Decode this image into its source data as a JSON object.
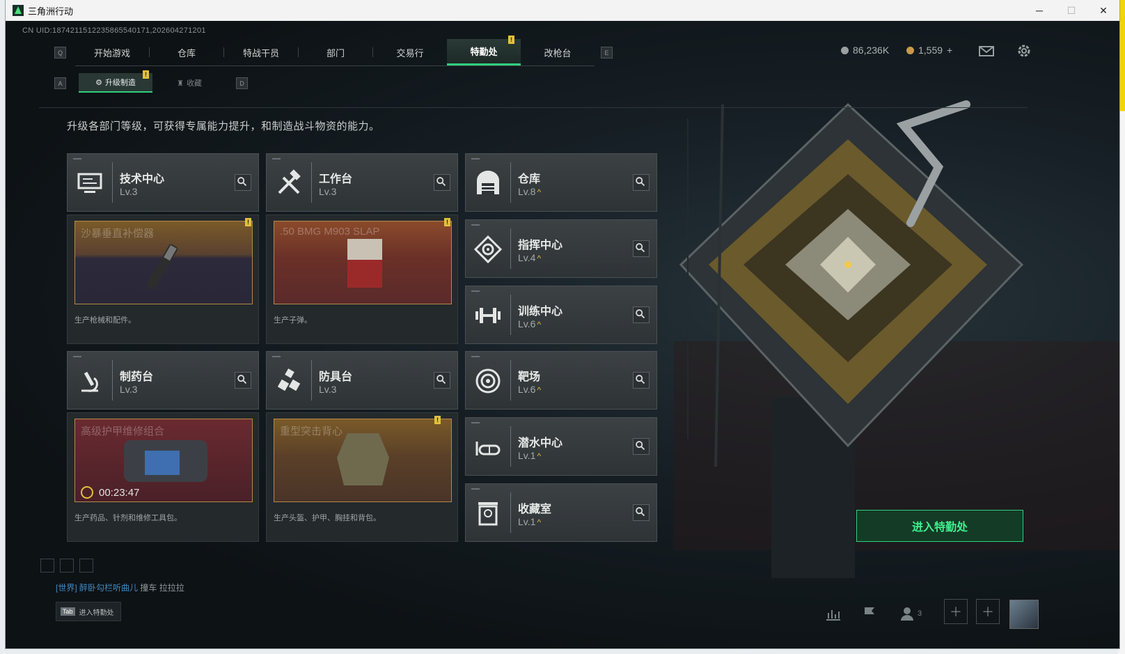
{
  "window": {
    "title": "三角洲行动"
  },
  "uid": "CN UID:1874211512235865540171,202604271201",
  "nav": {
    "key_left": "Q",
    "key_right": "E",
    "tabs": [
      "开始游戏",
      "仓库",
      "特战干员",
      "部门",
      "交易行",
      "特勤处",
      "改枪台"
    ],
    "active": "特勤处"
  },
  "subnav": {
    "key_left": "A",
    "key_right": "D",
    "tabs": [
      "升级制造",
      "收藏"
    ],
    "active": "升级制造"
  },
  "currency": {
    "silver": "86,236K",
    "gold": "1,559",
    "plus": "+"
  },
  "description": "升级各部门等级，可获得专属能力提升，和制造战斗物资的能力。",
  "departments": {
    "tech": {
      "name": "技术中心",
      "level": "Lv.3",
      "icon": "monitor-icon"
    },
    "workbench": {
      "name": "工作台",
      "level": "Lv.3",
      "icon": "tools-icon"
    },
    "warehouse": {
      "name": "仓库",
      "level": "Lv.8",
      "icon": "warehouse-icon"
    },
    "command": {
      "name": "指挥中心",
      "level": "Lv.4",
      "icon": "command-icon"
    },
    "training": {
      "name": "训练中心",
      "level": "Lv.6",
      "icon": "dumbbell-icon"
    },
    "pharmacy": {
      "name": "制药台",
      "level": "Lv.3",
      "icon": "microscope-icon"
    },
    "armor": {
      "name": "防具台",
      "level": "Lv.3",
      "icon": "armor-icon"
    },
    "range": {
      "name": "靶场",
      "level": "Lv.6",
      "icon": "target-icon"
    },
    "diving": {
      "name": "潜水中心",
      "level": "Lv.1",
      "icon": "goggles-icon"
    },
    "collection": {
      "name": "收藏室",
      "level": "Lv.1",
      "icon": "trophy-icon"
    }
  },
  "production": {
    "tech": {
      "item": "沙暴垂直补偿器",
      "desc": "生产枪械和配件。"
    },
    "workbench": {
      "item": ".50 BMG M903 SLAP",
      "desc": "生产子弹。"
    },
    "pharmacy": {
      "item": "高级护甲维修组合",
      "desc": "生产药品、针剂和维修工具包。",
      "timer": "00:23:47"
    },
    "armor": {
      "item": "重型突击背心",
      "desc": "生产头盔、护甲、胸挂和背包。"
    }
  },
  "enter_button": "进入特勤处",
  "chat": {
    "channel": "[世界]",
    "name": "醉卧勾栏听曲儿",
    "message": "撞车  拉拉拉"
  },
  "tab_hint": {
    "key": "Tab",
    "label": "进入特勤处"
  },
  "squad_count": "3",
  "badge": "!",
  "up_arrow": "^",
  "colors": {
    "accent": "#2fd07e",
    "alert": "#e2c13d",
    "bg": "#101417"
  }
}
